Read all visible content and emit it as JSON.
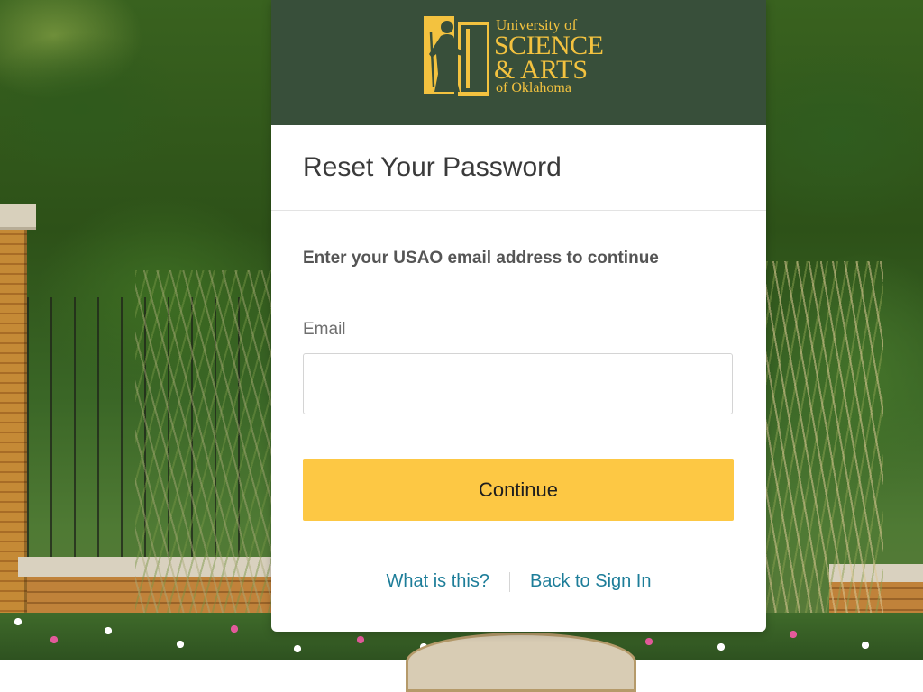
{
  "brand": {
    "line1": "University of",
    "line2": "SCIENCE",
    "line3": "& ARTS",
    "line4": "of Oklahoma",
    "color": "#f3c23f",
    "header_bg": "#384f3a"
  },
  "page": {
    "title": "Reset Your Password",
    "instruction": "Enter your USAO email address to continue"
  },
  "form": {
    "email_label": "Email",
    "email_value": "",
    "email_placeholder": ""
  },
  "actions": {
    "continue_label": "Continue",
    "continue_color": "#fdc844"
  },
  "links": {
    "help_label": "What is this?",
    "back_label": "Back to Sign In",
    "color": "#1d7d99"
  }
}
